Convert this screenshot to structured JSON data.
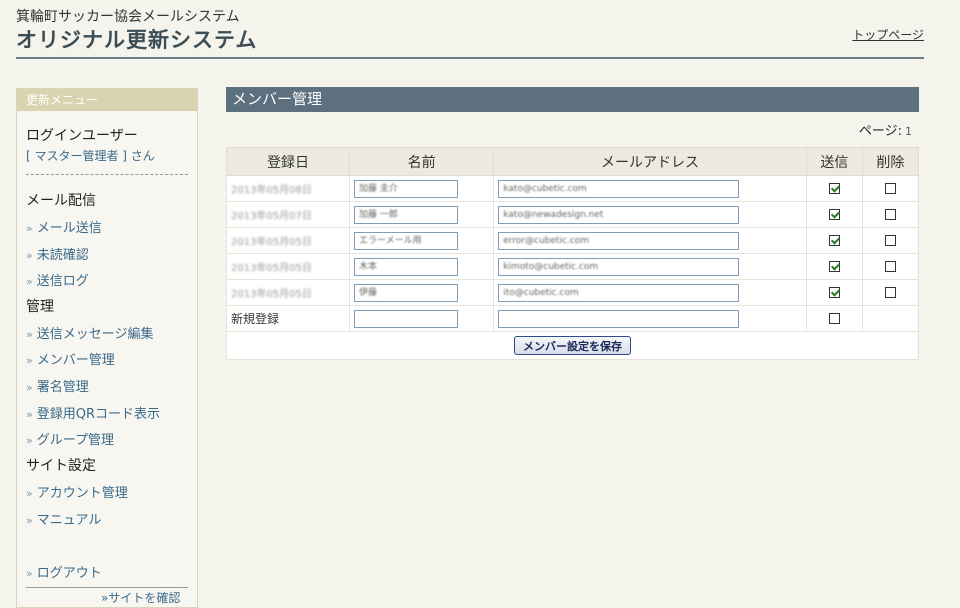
{
  "header": {
    "site_name": "箕輪町サッカー協会メールシステム",
    "title": "オリジナル更新システム",
    "top_link": "トップページ"
  },
  "sidebar": {
    "heading": "更新メニュー",
    "login_label": "ログインユーザー",
    "login_user": "[ マスター管理者 ] さん",
    "sections": {
      "mail": "メール配信",
      "manage": "管理",
      "site": "サイト設定"
    },
    "items": {
      "send_mail": "メール送信",
      "unread": "未読確認",
      "send_log": "送信ログ",
      "edit_message": "送信メッセージ編集",
      "member_manage": "メンバー管理",
      "signature": "署名管理",
      "qr": "登録用QRコード表示",
      "group": "グループ管理",
      "account": "アカウント管理",
      "manual": "マニュアル",
      "logout": "ログアウト",
      "confirm_site": "サイトを確認"
    }
  },
  "main": {
    "title": "メンバー管理",
    "page_label": "ページ:",
    "page_number": "1",
    "columns": {
      "date": "登録日",
      "name": "名前",
      "email": "メールアドレス",
      "send": "送信",
      "delete": "削除"
    },
    "rows": [
      {
        "date": "2013年05月08日",
        "name": "加藤 圭介",
        "email": "kato@cubetic.com",
        "send": true,
        "delete": false
      },
      {
        "date": "2013年05月07日",
        "name": "加藤 一郎",
        "email": "kato@newadesign.net",
        "send": true,
        "delete": false
      },
      {
        "date": "2013年05月05日",
        "name": "エラーメール用",
        "email": "error@cubetic.com",
        "send": true,
        "delete": false
      },
      {
        "date": "2013年05月05日",
        "name": "木本",
        "email": "kimoto@cubetic.com",
        "send": true,
        "delete": false
      },
      {
        "date": "2013年05月05日",
        "name": "伊藤",
        "email": "ito@cubetic.com",
        "send": true,
        "delete": false
      }
    ],
    "new_label": "新規登録",
    "save_button": "メンバー設定を保存"
  }
}
